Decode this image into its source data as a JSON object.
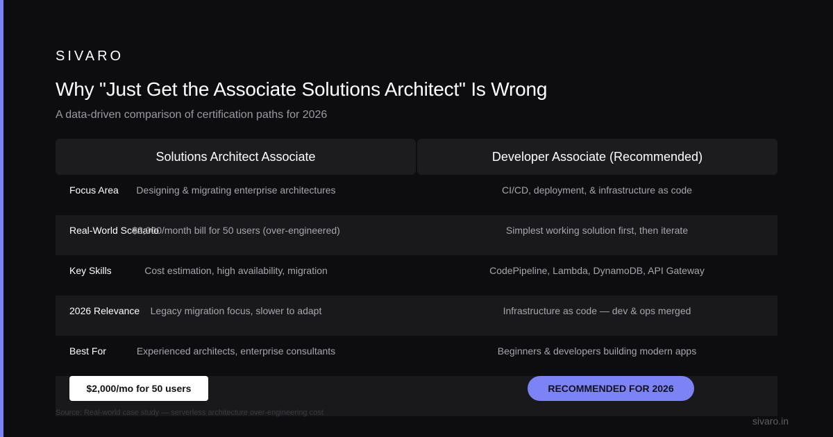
{
  "brand": "SIVARO",
  "title": "Why \"Just Get the Associate Solutions Architect\" Is Wrong",
  "subtitle": "A data-driven comparison of certification paths for 2026",
  "table": {
    "headers": [
      "Solutions Architect Associate",
      "Developer Associate (Recommended)"
    ],
    "rows": [
      {
        "label": "Focus Area",
        "left": "Designing & migrating enterprise architectures",
        "right": "CI/CD, deployment, & infrastructure as code"
      },
      {
        "label": "Real-World Scenario",
        "left": "$2,000/month bill for 50 users (over-engineered)",
        "right": "Simplest working solution first, then iterate"
      },
      {
        "label": "Key Skills",
        "left": "Cost estimation, high availability, migration",
        "right": "CodePipeline, Lambda, DynamoDB, API Gateway"
      },
      {
        "label": "2026 Relevance",
        "left": "Legacy migration focus, slower to adapt",
        "right": "Infrastructure as code — dev & ops merged"
      },
      {
        "label": "Best For",
        "left": "Experienced architects, enterprise consultants",
        "right": "Beginners & developers building modern apps"
      }
    ]
  },
  "badges": {
    "cost": "$2,000/mo for 50 users",
    "recommended": "RECOMMENDED FOR 2026"
  },
  "source": "Source: Real-world case study — serverless architecture over-engineering cost",
  "domain": "sivaro.in",
  "colors": {
    "accent": "#7c83f5",
    "background": "#0d0d0f",
    "header_cell": "#1c1c1f",
    "alt_row": "#19191c"
  }
}
